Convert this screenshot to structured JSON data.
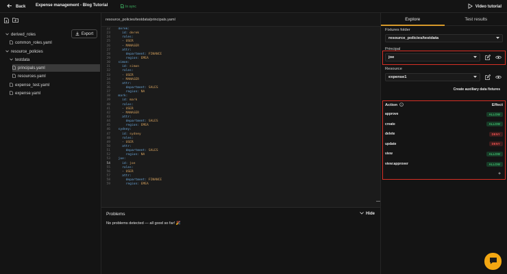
{
  "header": {
    "back_label": "Back",
    "title": "Expense management - Blog Tutorial",
    "sync_status": "In sync",
    "video_label": "Video tutorial"
  },
  "sidebar": {
    "export_label": "Export",
    "tree": [
      {
        "label": "derived_roles",
        "kind": "folder",
        "expanded": true
      },
      {
        "label": "common_roles.yaml",
        "kind": "file"
      },
      {
        "label": "resource_policies",
        "kind": "folder",
        "expanded": true
      },
      {
        "label": "testdata",
        "kind": "folder",
        "expanded": true
      },
      {
        "label": "principals.yaml",
        "kind": "file",
        "selected": true
      },
      {
        "label": "resources.yaml",
        "kind": "file"
      },
      {
        "label": "expense_test.yaml",
        "kind": "file"
      },
      {
        "label": "expense.yaml",
        "kind": "file"
      }
    ]
  },
  "editor": {
    "tab_label": "resource_policies/testdata/principals.yaml",
    "current_line": 54,
    "lines": [
      {
        "n": 22,
        "indent": "  ",
        "key": "derek:",
        "val": ""
      },
      {
        "n": 23,
        "indent": "    ",
        "key": "id:",
        "val": " derek"
      },
      {
        "n": 24,
        "indent": "    ",
        "key": "roles:",
        "val": ""
      },
      {
        "n": 25,
        "indent": "    ",
        "key": "- ",
        "val": "USER"
      },
      {
        "n": 26,
        "indent": "    ",
        "key": "- ",
        "val": "MANAGER"
      },
      {
        "n": 27,
        "indent": "    ",
        "key": "attr:",
        "val": ""
      },
      {
        "n": 28,
        "indent": "      ",
        "key": "department:",
        "val": " FINANCE"
      },
      {
        "n": 29,
        "indent": "      ",
        "key": "region:",
        "val": " EMEA"
      },
      {
        "n": 30,
        "indent": "  ",
        "key": "simon:",
        "val": ""
      },
      {
        "n": 31,
        "indent": "    ",
        "key": "id:",
        "val": " simon"
      },
      {
        "n": 32,
        "indent": "    ",
        "key": "roles:",
        "val": ""
      },
      {
        "n": 33,
        "indent": "    ",
        "key": "- ",
        "val": "USER"
      },
      {
        "n": 34,
        "indent": "    ",
        "key": "- ",
        "val": "MANAGER"
      },
      {
        "n": 35,
        "indent": "    ",
        "key": "attr:",
        "val": ""
      },
      {
        "n": 36,
        "indent": "      ",
        "key": "department:",
        "val": " SALES"
      },
      {
        "n": 37,
        "indent": "      ",
        "key": "region:",
        "val": " NA"
      },
      {
        "n": 38,
        "indent": "  ",
        "key": "mark:",
        "val": ""
      },
      {
        "n": 39,
        "indent": "    ",
        "key": "id:",
        "val": " mark"
      },
      {
        "n": 40,
        "indent": "    ",
        "key": "roles:",
        "val": ""
      },
      {
        "n": 41,
        "indent": "    ",
        "key": "- ",
        "val": "USER"
      },
      {
        "n": 42,
        "indent": "    ",
        "key": "- ",
        "val": "MANAGER"
      },
      {
        "n": 43,
        "indent": "    ",
        "key": "attr:",
        "val": ""
      },
      {
        "n": 44,
        "indent": "      ",
        "key": "department:",
        "val": " SALES"
      },
      {
        "n": 45,
        "indent": "      ",
        "key": "region:",
        "val": " EMEA"
      },
      {
        "n": 46,
        "indent": "  ",
        "key": "sydney:",
        "val": ""
      },
      {
        "n": 47,
        "indent": "    ",
        "key": "id:",
        "val": " sydney"
      },
      {
        "n": 48,
        "indent": "    ",
        "key": "roles:",
        "val": ""
      },
      {
        "n": 49,
        "indent": "    ",
        "key": "- ",
        "val": "USER"
      },
      {
        "n": 50,
        "indent": "    ",
        "key": "attr:",
        "val": ""
      },
      {
        "n": 51,
        "indent": "      ",
        "key": "department:",
        "val": " SALES"
      },
      {
        "n": 52,
        "indent": "      ",
        "key": "region:",
        "val": " NA"
      },
      {
        "n": 53,
        "indent": "  ",
        "key": "joe:",
        "val": ""
      },
      {
        "n": 54,
        "indent": "    ",
        "key": "id:",
        "val": " joe"
      },
      {
        "n": 55,
        "indent": "    ",
        "key": "roles:",
        "val": ""
      },
      {
        "n": 56,
        "indent": "    ",
        "key": "- ",
        "val": "USER"
      },
      {
        "n": 57,
        "indent": "    ",
        "key": "attr:",
        "val": ""
      },
      {
        "n": 58,
        "indent": "      ",
        "key": "department:",
        "val": " FINANCE"
      },
      {
        "n": 59,
        "indent": "      ",
        "key": "region:",
        "val": " EMEA"
      }
    ]
  },
  "problems": {
    "title": "Problems",
    "hide_label": "Hide",
    "message": "No problems detected — all good so far! 🎉"
  },
  "right_panel": {
    "tabs": [
      {
        "label": "Explore",
        "active": true
      },
      {
        "label": "Test results",
        "active": false
      }
    ],
    "fixtures_label": "Fixtures folder",
    "fixtures_value": "resource_policies/testdata",
    "principal_label": "Principal",
    "principal_value": "joe",
    "resource_label": "Resource",
    "resource_value": "expense1",
    "aux_link": "Create auxiliary data fixtures",
    "action_header": "Action",
    "effect_header": "Effect",
    "add_label": "+",
    "actions": [
      {
        "name": "approve",
        "effect": "ALLOW"
      },
      {
        "name": "create",
        "effect": "ALLOW"
      },
      {
        "name": "delete",
        "effect": "DENY"
      },
      {
        "name": "update",
        "effect": "DENY"
      },
      {
        "name": "view",
        "effect": "ALLOW"
      },
      {
        "name": "view:approver",
        "effect": "ALLOW"
      }
    ]
  },
  "colors": {
    "accent": "#d89a2a",
    "highlight_box": "#d93025",
    "allow": "#3fc06f",
    "deny": "#ef5350",
    "sync": "#3fb463"
  }
}
